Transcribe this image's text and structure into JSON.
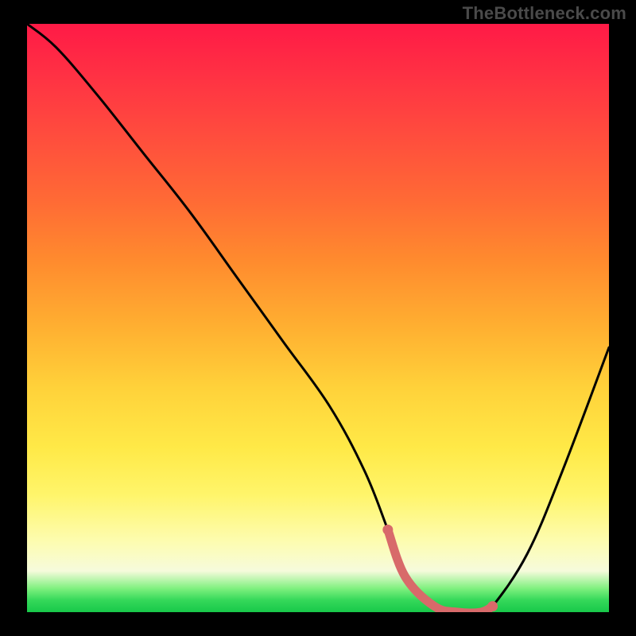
{
  "watermark": "TheBottleneck.com",
  "colors": {
    "page_bg": "#000000",
    "watermark_text": "#4a4a4a",
    "curve": "#000000",
    "highlight": "#d86a6a",
    "gradient_top": "#ff1a46",
    "gradient_bottom": "#18c84a"
  },
  "chart_data": {
    "type": "line",
    "title": "",
    "xlabel": "",
    "ylabel": "",
    "xlim": [
      0,
      100
    ],
    "ylim": [
      0,
      100
    ],
    "series": [
      {
        "name": "bottleneck_curve",
        "x": [
          0,
          5,
          12,
          20,
          28,
          36,
          44,
          52,
          58,
          62,
          65,
          70,
          74,
          78,
          80,
          86,
          92,
          100
        ],
        "values": [
          100,
          96,
          88,
          78,
          68,
          57,
          46,
          35,
          24,
          14,
          6,
          1,
          0,
          0,
          1,
          10,
          24,
          45
        ]
      }
    ],
    "highlight_segment": {
      "series": "bottleneck_curve",
      "x_start": 62,
      "x_end": 80
    },
    "annotations": []
  }
}
